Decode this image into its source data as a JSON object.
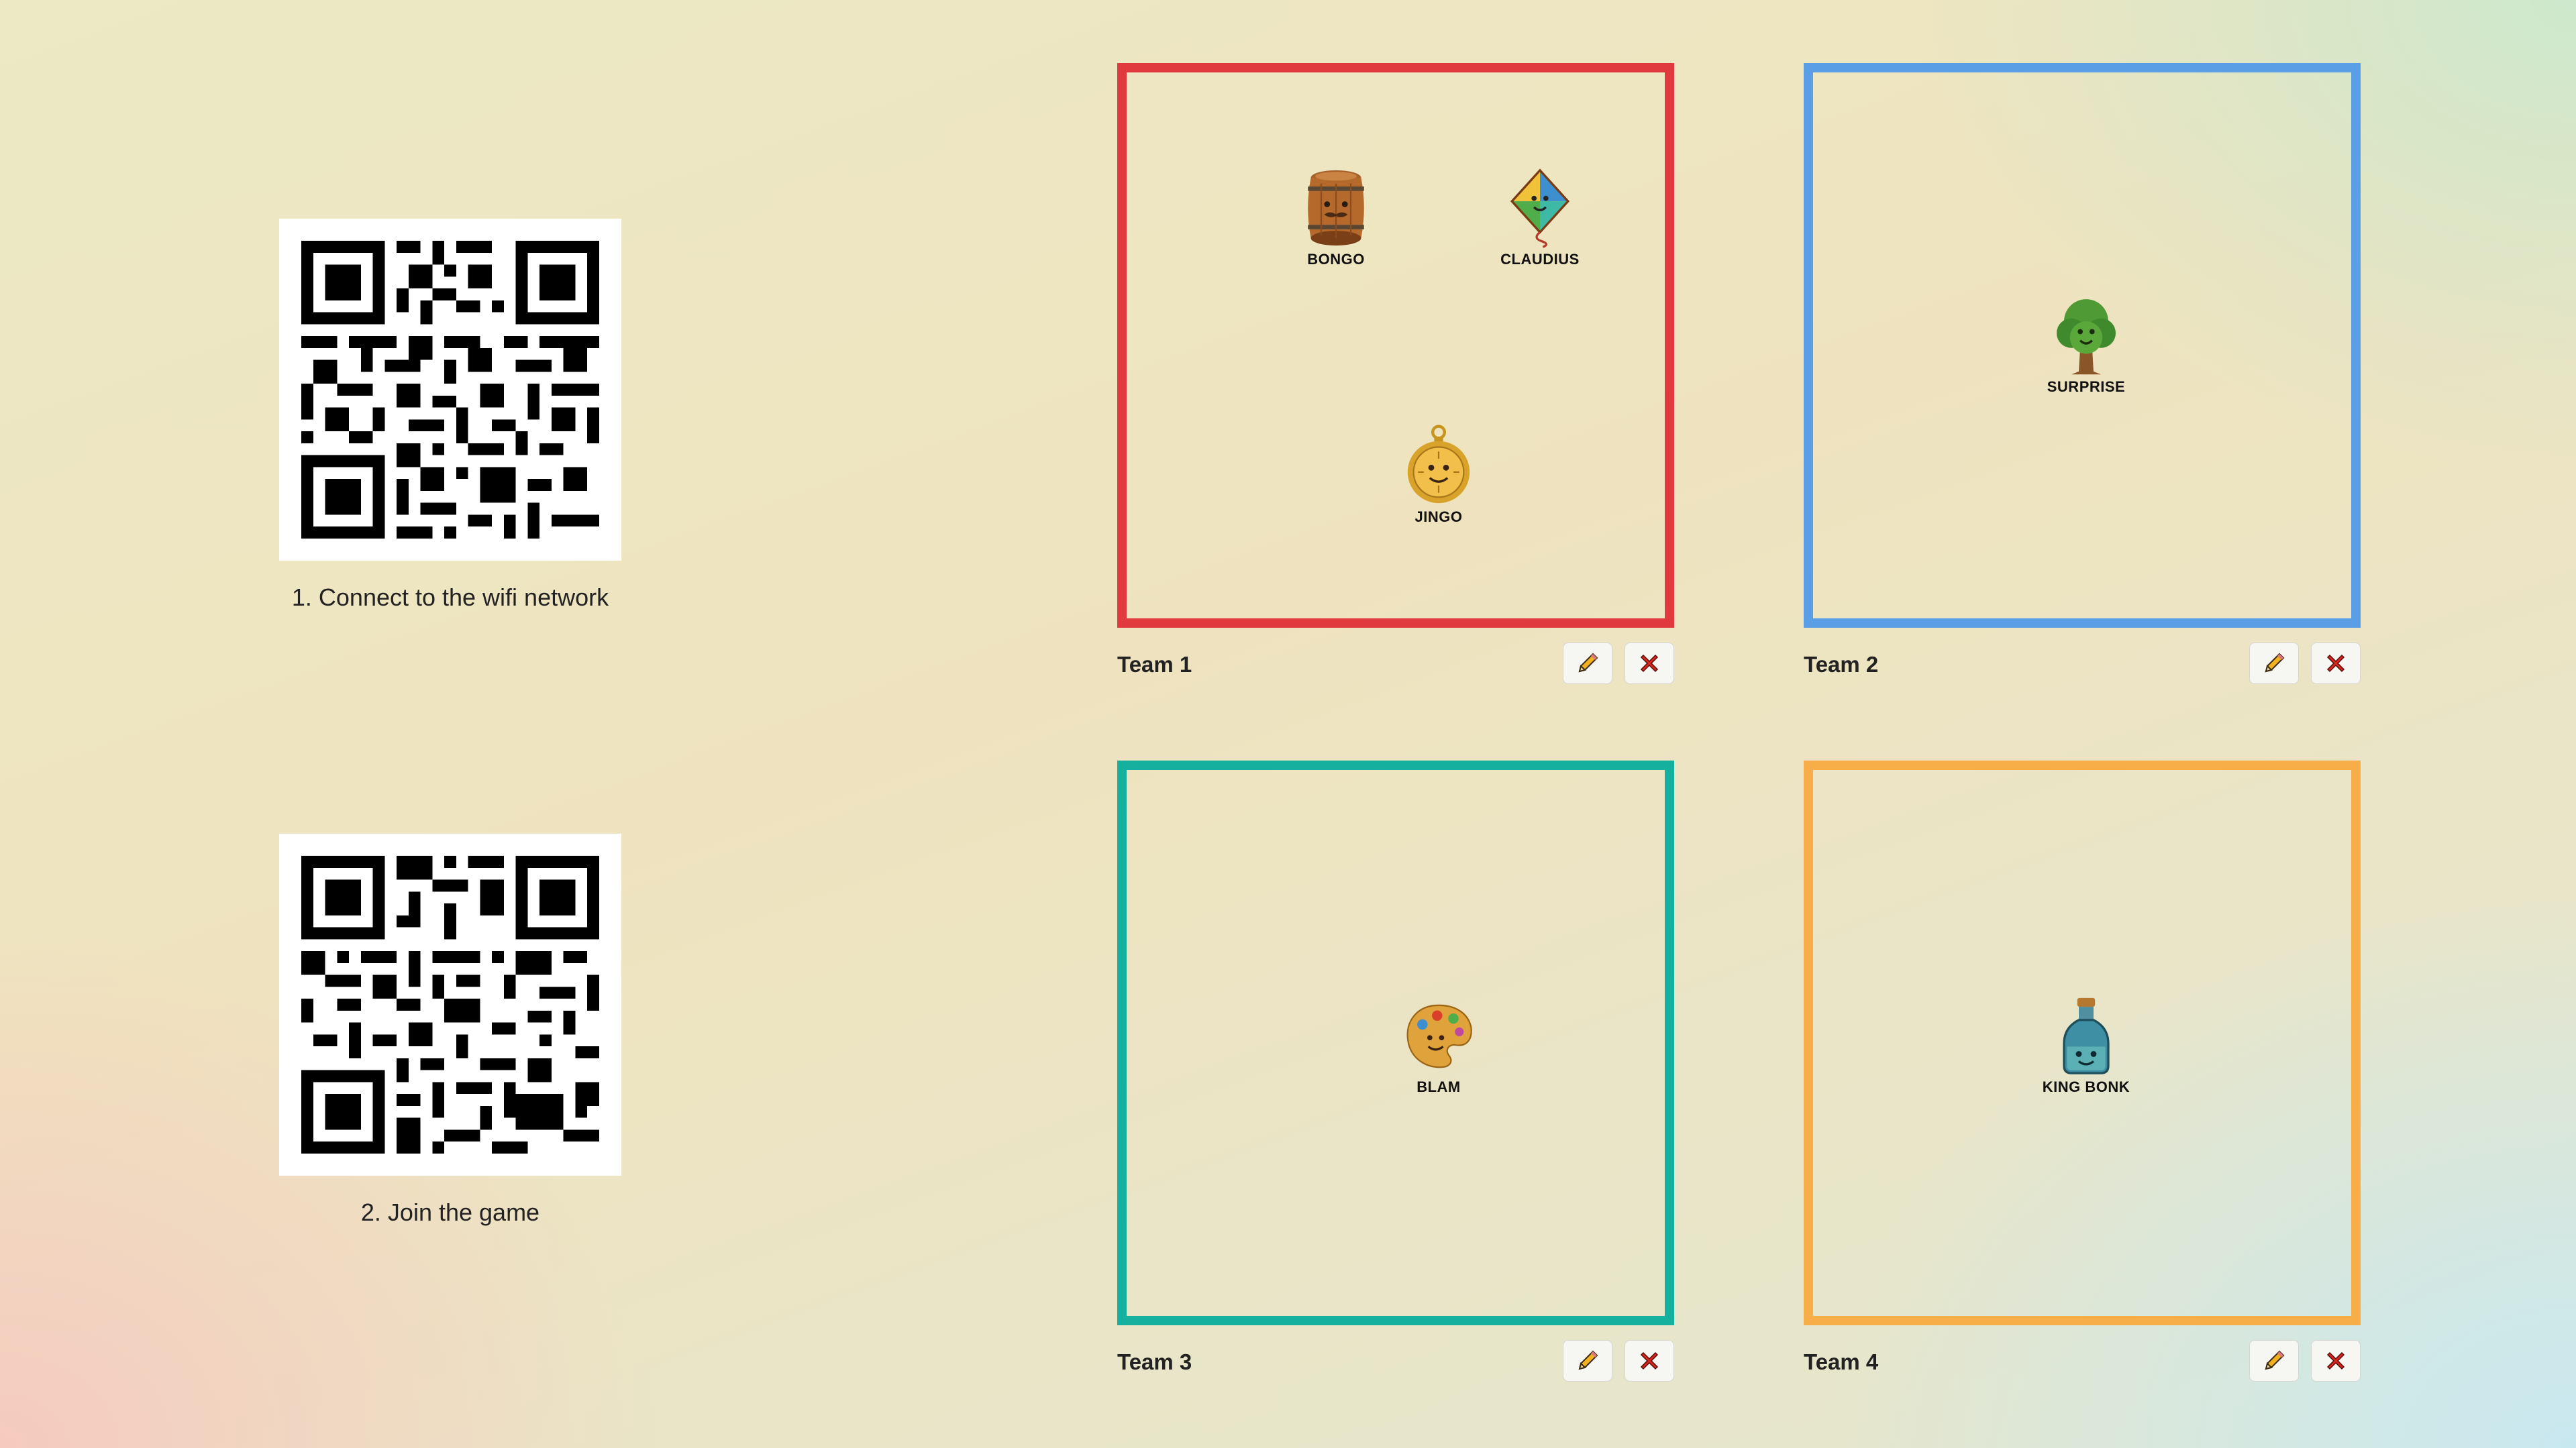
{
  "instructions": [
    {
      "caption": "1. Connect to the wifi network",
      "icon": "wifi-qr-code"
    },
    {
      "caption": "2. Join the game",
      "icon": "join-qr-code"
    }
  ],
  "teams": [
    {
      "name": "Team 1",
      "color": "#e03a3e",
      "edit_icon": "pencil-icon",
      "delete_icon": "close-icon",
      "players": [
        {
          "name": "BONGO",
          "icon": "barrel-icon"
        },
        {
          "name": "CLAUDIUS",
          "icon": "kite-icon"
        },
        {
          "name": "JINGO",
          "icon": "pocket-watch-icon"
        }
      ]
    },
    {
      "name": "Team 2",
      "color": "#5a9ee6",
      "edit_icon": "pencil-icon",
      "delete_icon": "close-icon",
      "players": [
        {
          "name": "SURPRISE",
          "icon": "tree-icon"
        }
      ]
    },
    {
      "name": "Team 3",
      "color": "#16b09e",
      "edit_icon": "pencil-icon",
      "delete_icon": "close-icon",
      "players": [
        {
          "name": "BLAM",
          "icon": "paint-palette-icon"
        }
      ]
    },
    {
      "name": "Team 4",
      "color": "#f7ad48",
      "edit_icon": "pencil-icon",
      "delete_icon": "close-icon",
      "players": [
        {
          "name": "KING BONK",
          "icon": "bottle-icon"
        }
      ]
    }
  ]
}
